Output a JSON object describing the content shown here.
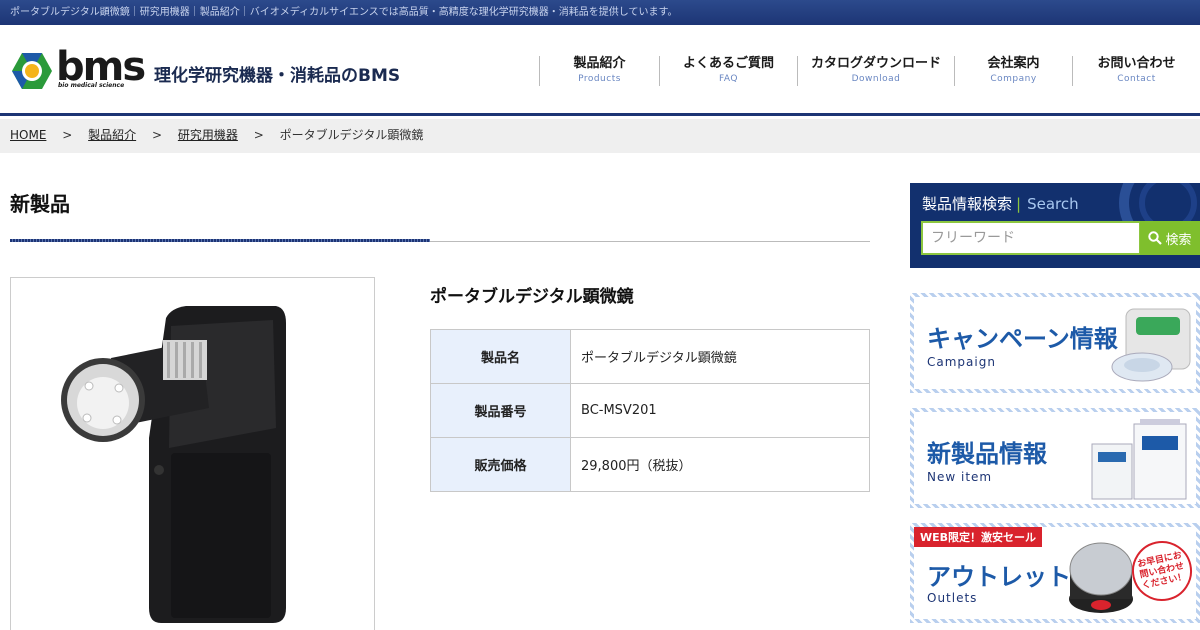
{
  "topbar": {
    "text": "ポータブルデジタル顕微鏡｜研究用機器｜製品紹介｜バイオメディカルサイエンスでは高品質・高精度な理化学研究機器・消耗品を提供しています。"
  },
  "logo": {
    "brand": "bms",
    "sub": "bio medical science",
    "tagline": "理化学研究機器・消耗品のBMS"
  },
  "nav": [
    {
      "jp": "製品紹介",
      "en": "Products"
    },
    {
      "jp": "よくあるご質問",
      "en": "FAQ"
    },
    {
      "jp": "カタログダウンロード",
      "en": "Download"
    },
    {
      "jp": "会社案内",
      "en": "Company"
    },
    {
      "jp": "お問い合わせ",
      "en": "Contact"
    }
  ],
  "breadcrumb": {
    "home": "HOME",
    "products": "製品紹介",
    "category": "研究用機器",
    "current": "ポータブルデジタル顕微鏡",
    "sep": ">"
  },
  "section": {
    "title": "新製品"
  },
  "product": {
    "name": "ポータブルデジタル顕微鏡",
    "spec": [
      {
        "label": "製品名",
        "value": "ポータブルデジタル顕微鏡"
      },
      {
        "label": "製品番号",
        "value": "BC-MSV201"
      },
      {
        "label": "販売価格",
        "value": "29,800円（税抜）"
      }
    ]
  },
  "search": {
    "title_jp": "製品情報検索",
    "divider": "|",
    "title_en": "Search",
    "placeholder": "フリーワード",
    "button": "検索"
  },
  "banners": {
    "campaign": {
      "jp": "キャンペーン情報",
      "en": "Campaign"
    },
    "newitem": {
      "jp": "新製品情報",
      "en": "New item"
    },
    "outlet": {
      "badge": "WEB限定！激安セール",
      "jp": "アウトレット",
      "en": "Outlets",
      "bubble": "お早目にお問い合わせください！"
    }
  },
  "colors": {
    "navy": "#1d3575",
    "accent_green": "#7fbf2d",
    "spec_header_bg": "#e8f0fc",
    "banner_text": "#1d5aa8"
  }
}
